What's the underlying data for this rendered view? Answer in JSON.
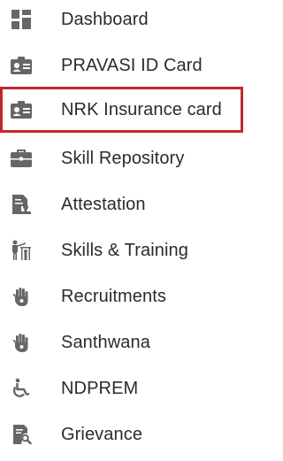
{
  "colors": {
    "icon": "#666666",
    "text": "#2b2b2b",
    "active_border": "#c1272d",
    "background": "#ffffff"
  },
  "menu": {
    "active_index": 2,
    "items": [
      {
        "label": "Dashboard",
        "icon": "dashboard-icon"
      },
      {
        "label": "PRAVASI ID Card",
        "icon": "id-card-icon"
      },
      {
        "label": "NRK Insurance card",
        "icon": "id-card-icon"
      },
      {
        "label": "Skill Repository",
        "icon": "briefcase-icon"
      },
      {
        "label": "Attestation",
        "icon": "document-stamp-icon"
      },
      {
        "label": "Skills & Training",
        "icon": "training-icon"
      },
      {
        "label": "Recruitments",
        "icon": "hand-icon"
      },
      {
        "label": "Santhwana",
        "icon": "hand-icon"
      },
      {
        "label": "NDPREM",
        "icon": "wheelchair-icon"
      },
      {
        "label": "Grievance",
        "icon": "document-search-icon"
      }
    ]
  }
}
